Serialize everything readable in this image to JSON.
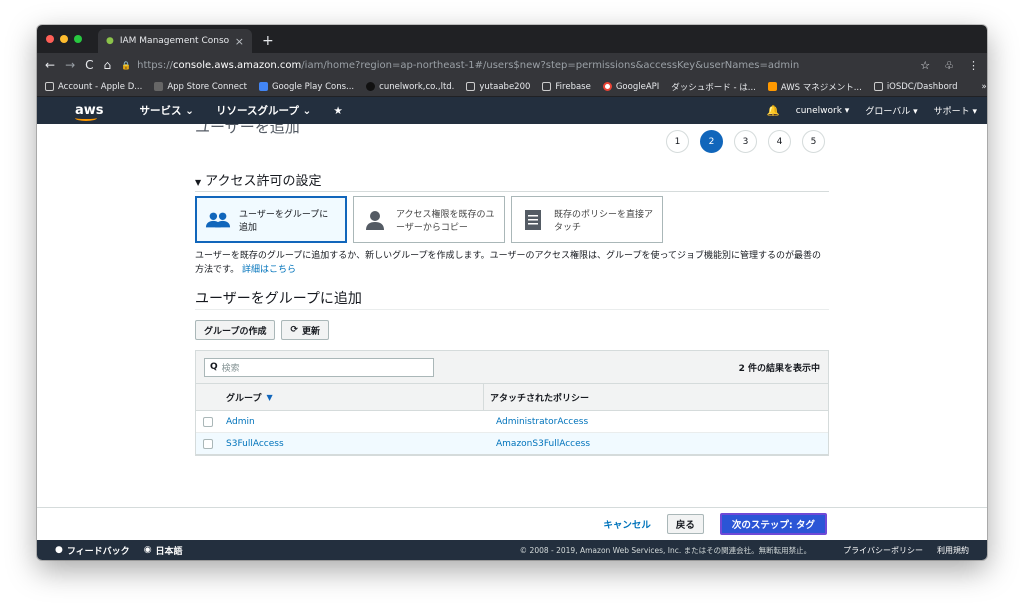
{
  "browser": {
    "tab_title": "IAM Management Console",
    "url_scheme": "https://",
    "url_host": "console.aws.amazon.com",
    "url_path": "/iam/home?region=ap-northeast-1#/users$new?step=permissions&accessKey&userNames=admin",
    "bookmarks": [
      "Account - Apple D...",
      "App Store Connect",
      "Google Play Cons...",
      "cunelwork,co.,ltd.",
      "yutaabe200",
      "Firebase",
      "GoogleAPI",
      "ダッシュボード - は...",
      "AWS マネジメント...",
      "iOSDC/Dashbord"
    ],
    "more": "»"
  },
  "awsnav": {
    "logo": "aws",
    "services": "サービス ⌄",
    "resource_groups": "リソースグループ ⌄",
    "user": "cunelwork ▾",
    "region": "グローバル ▾",
    "support": "サポート ▾"
  },
  "page": {
    "title": "ユーザーを追加",
    "steps": [
      "1",
      "2",
      "3",
      "4",
      "5"
    ],
    "section_title": "アクセス許可の設定",
    "options": [
      {
        "label": "ユーザーをグループに追加"
      },
      {
        "label": "アクセス権限を既存のユーザーからコピー"
      },
      {
        "label": "既存のポリシーを直接アタッチ"
      }
    ],
    "description": "ユーザーを既存のグループに追加するか、新しいグループを作成します。ユーザーのアクセス権限は、グループを使ってジョブ機能別に管理するのが最善の方法です。",
    "learn_more": "詳細はこちら",
    "subheading": "ユーザーをグループに追加",
    "create_group": "グループの作成",
    "refresh": "更新",
    "search_placeholder": "検索",
    "result_count": "2 件の結果を表示中",
    "columns": {
      "group": "グループ",
      "policies": "アタッチされたポリシー"
    },
    "rows": [
      {
        "group": "Admin",
        "policy": "AdministratorAccess"
      },
      {
        "group": "S3FullAccess",
        "policy": "AmazonS3FullAccess"
      }
    ]
  },
  "actions": {
    "cancel": "キャンセル",
    "back": "戻る",
    "next": "次のステップ: タグ"
  },
  "footer": {
    "feedback": "フィードバック",
    "language": "日本語",
    "copyright": "© 2008 - 2019, Amazon Web Services, Inc. またはその関連会社。無断転用禁止。",
    "privacy": "プライバシーポリシー",
    "terms": "利用規約"
  },
  "colors": {
    "aws_nav": "#232f3e",
    "accent": "#1166bb",
    "link": "#0073bb",
    "next_button": "#2b55d6"
  }
}
